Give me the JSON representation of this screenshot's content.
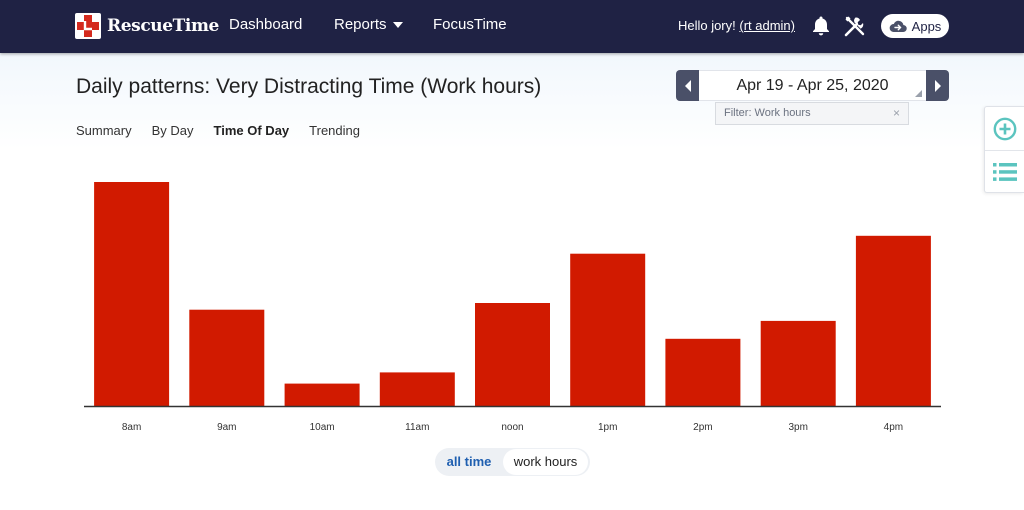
{
  "nav": {
    "brand": "RescueTime",
    "links": {
      "dashboard": "Dashboard",
      "reports": "Reports",
      "focustime": "FocusTime"
    },
    "greeting": "Hello jory!",
    "admin_link": "(rt admin)",
    "apps_label": "Apps"
  },
  "header": {
    "title": "Daily patterns: Very Distracting Time (Work hours)",
    "date_range": "Apr 19 - Apr 25, 2020",
    "filter_label": "Filter: Work hours",
    "filter_clear": "×"
  },
  "subtabs": [
    "Summary",
    "By Day",
    "Time Of Day",
    "Trending"
  ],
  "active_subtab": "Time Of Day",
  "icons": {
    "brand": "rescuetime-logo-icon",
    "reports_caret": "chevron-down-icon",
    "notifications": "bell-icon",
    "tools": "tools-icon",
    "apps": "cloud-icon",
    "prev": "chevron-left-icon",
    "next": "chevron-right-icon",
    "side_add": "plus-circle-icon",
    "side_list": "list-icon"
  },
  "colors": {
    "nav_bg": "#1f2244",
    "bar": "#d11a00",
    "side_icon": "#5bc4bf",
    "toggle_active": "#1f5fb0"
  },
  "chart_data": {
    "type": "bar",
    "categories": [
      "8am",
      "9am",
      "10am",
      "11am",
      "noon",
      "1pm",
      "2pm",
      "3pm",
      "4pm"
    ],
    "values": [
      100,
      43,
      10,
      15,
      46,
      68,
      30,
      38,
      76
    ],
    "ylim": [
      0,
      100
    ],
    "grid": false,
    "legend": "none"
  },
  "toggle": {
    "all_time": "all time",
    "work_hours": "work hours",
    "selected": "work hours"
  }
}
